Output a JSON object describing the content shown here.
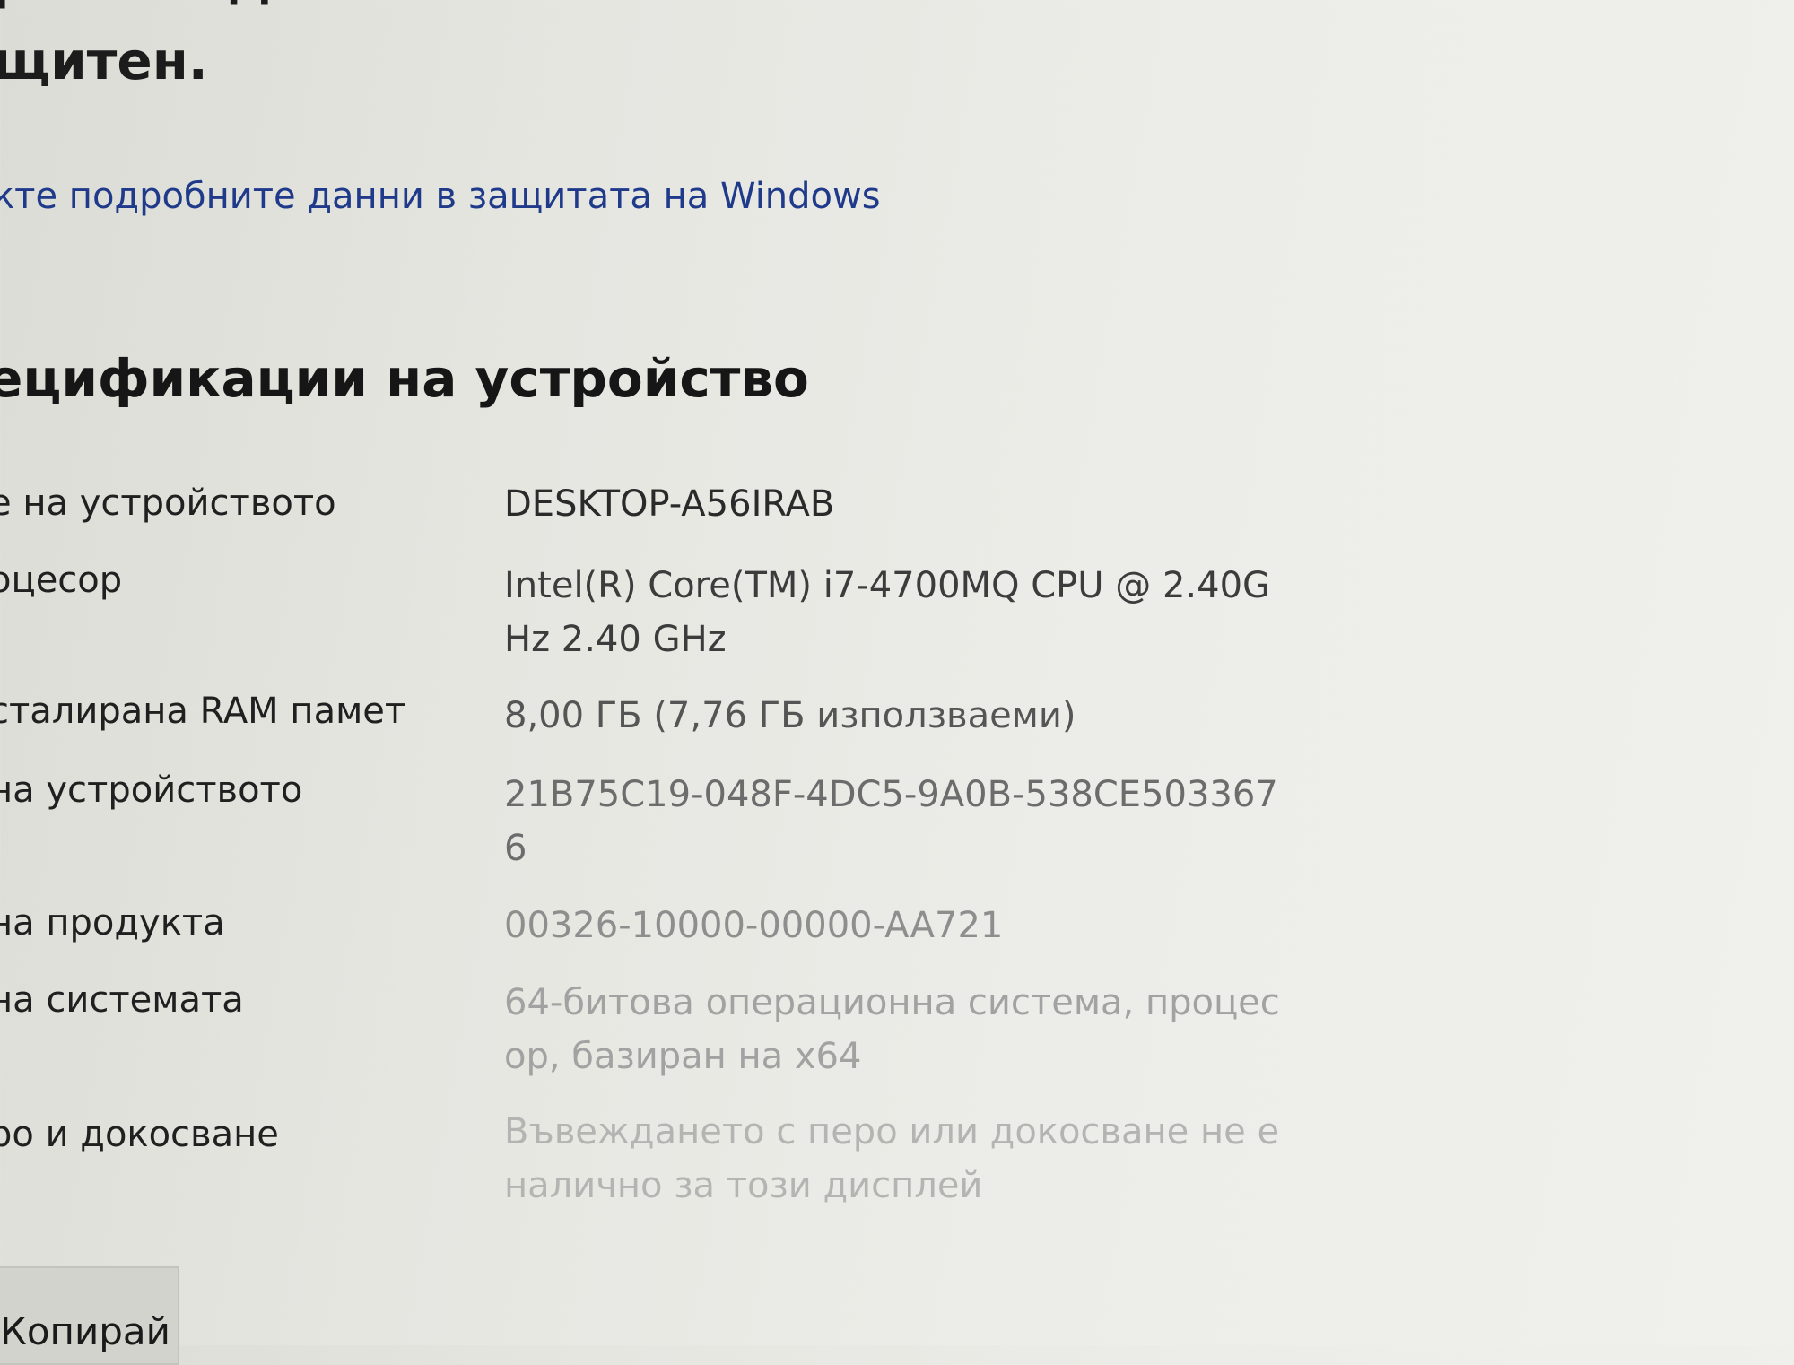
{
  "security": {
    "top_fragment": "р    незнодава и с",
    "heading_fragment": "щитен.",
    "link_text": "кте подробните данни в защитата на Windows"
  },
  "specs": {
    "title": "ецификации на устройство",
    "rows": [
      {
        "label": "е на устройството",
        "value": "DESKTOP-A56IRAB"
      },
      {
        "label": "оцесор",
        "value": "Intel(R) Core(TM) i7-4700MQ CPU @ 2.40GHz   2.40 GHz"
      },
      {
        "label": "сталирана RAM памет",
        "value": "8,00 ГБ (7,76 ГБ използваеми)"
      },
      {
        "label": "на устройството",
        "value": "21B75C19-048F-4DC5-9A0B-538CE503367 6"
      },
      {
        "label": "на продукта",
        "value": "00326-10000-00000-AA721"
      },
      {
        "label": "на системата",
        "value": "64-битова операционна система, процесор, базиран на x64"
      },
      {
        "label": "ро и докосване",
        "value": "Въвеждането с перо или докосване не е налично за този дисплей"
      }
    ],
    "copy_button_label": "Копирай"
  }
}
